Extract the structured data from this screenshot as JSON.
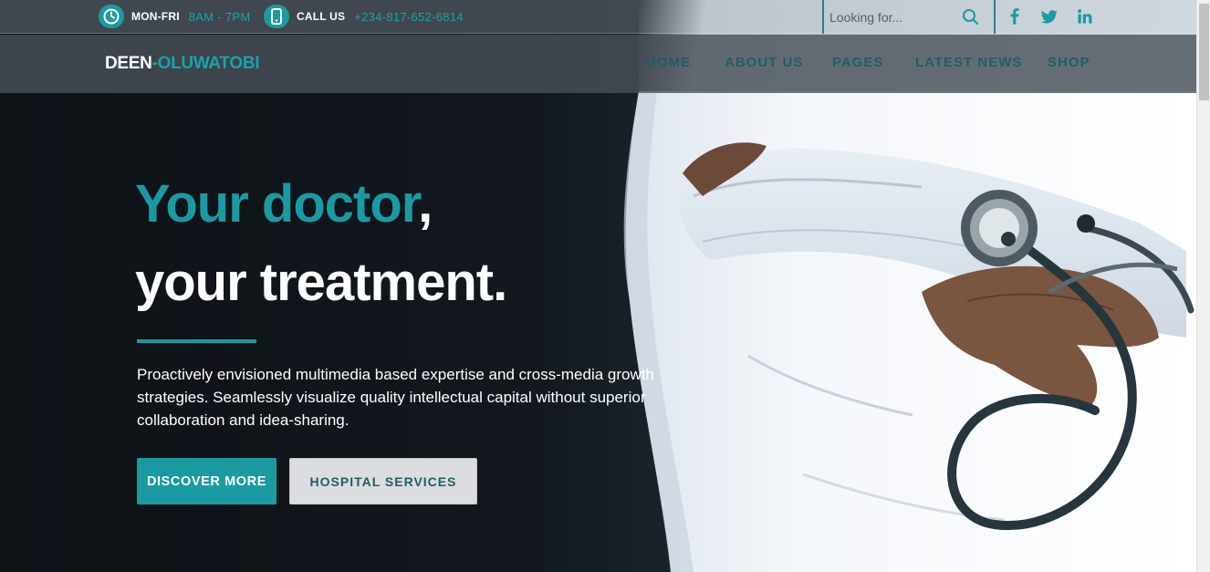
{
  "topbar": {
    "hours_label": "MON-FRI",
    "hours_value": "8AM - 7PM",
    "call_label": "CALL US",
    "call_value": "+234-817-652-6814",
    "search_placeholder": "Looking for..."
  },
  "brand": {
    "part1": "DEEN",
    "part2": "-OLUWATOBI"
  },
  "nav": {
    "items": [
      "HOME",
      "ABOUT US",
      "PAGES",
      "LATEST NEWS",
      "SHOP"
    ]
  },
  "hero": {
    "headline_teal": "Your doctor",
    "headline_comma": ",",
    "headline_line2": "your treatment.",
    "description": "Proactively envisioned multimedia based expertise and cross-media growth strategies. Seamlessly visualize quality intellectual capital without superior collaboration and idea-sharing.",
    "primary_button": "DISCOVER MORE",
    "secondary_button": "HOSPITAL SERVICES"
  },
  "colors": {
    "accent": "#1a9ba1",
    "nav_text": "#1d5f66",
    "dark_bg": "#0f1419"
  }
}
